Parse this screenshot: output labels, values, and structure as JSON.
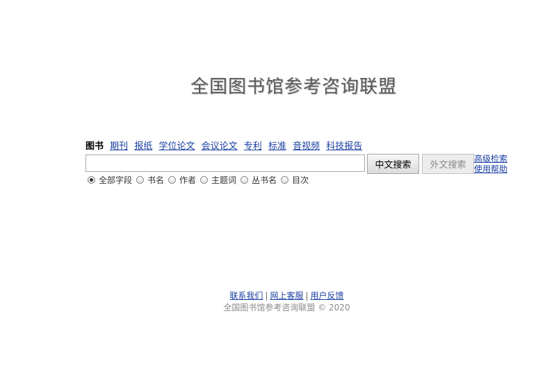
{
  "header": {
    "logo_text": "全国图书馆参考咨询联盟"
  },
  "tabs": [
    {
      "label": "图书",
      "active": true
    },
    {
      "label": "期刊",
      "active": false
    },
    {
      "label": "报纸",
      "active": false
    },
    {
      "label": "学位论文",
      "active": false
    },
    {
      "label": "会议论文",
      "active": false
    },
    {
      "label": "专利",
      "active": false
    },
    {
      "label": "标准",
      "active": false
    },
    {
      "label": "音视频",
      "active": false
    },
    {
      "label": "科技报告",
      "active": false
    }
  ],
  "search": {
    "value": "",
    "placeholder": "",
    "chinese_search_label": "中文搜索",
    "foreign_search_label": "外文搜索"
  },
  "side_links": {
    "advanced_search": "高级检索",
    "help": "使用帮助"
  },
  "field_options": [
    {
      "label": "全部字段",
      "checked": true
    },
    {
      "label": "书名",
      "checked": false
    },
    {
      "label": "作者",
      "checked": false
    },
    {
      "label": "主题词",
      "checked": false
    },
    {
      "label": "丛书名",
      "checked": false
    },
    {
      "label": "目次",
      "checked": false
    }
  ],
  "footer": {
    "contact": "联系我们",
    "online_service": "网上客服",
    "feedback": "用户反馈",
    "separator": "|",
    "copyright": "全国图书馆参考咨询联盟 © 2020"
  }
}
